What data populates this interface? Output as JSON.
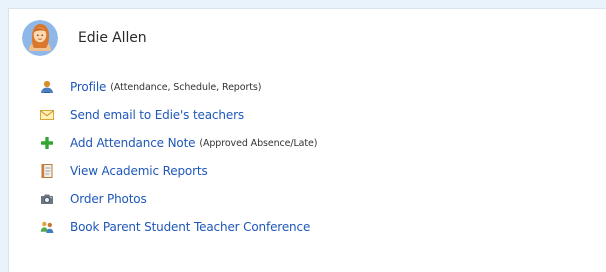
{
  "student": {
    "name": "Edie Allen",
    "avatar_icon": "female-student-avatar-icon"
  },
  "links": [
    {
      "icon": "person-profile-icon",
      "label": "Profile",
      "note": "(Attendance, Schedule, Reports)"
    },
    {
      "icon": "envelope-icon",
      "label": "Send email to Edie's teachers",
      "note": ""
    },
    {
      "icon": "green-plus-icon",
      "label": "Add Attendance Note",
      "note": "(Approved Absence/Late)"
    },
    {
      "icon": "report-document-icon",
      "label": "View Academic Reports",
      "note": ""
    },
    {
      "icon": "camera-icon",
      "label": "Order Photos",
      "note": ""
    },
    {
      "icon": "conference-people-icon",
      "label": "Book Parent Student Teacher Conference",
      "note": ""
    }
  ],
  "colors": {
    "page_background": "#e8f3fb",
    "card_background": "#ffffff",
    "link": "#1e58b8",
    "plus_green": "#33a532"
  }
}
